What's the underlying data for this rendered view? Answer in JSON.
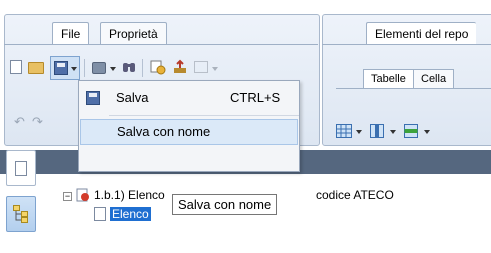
{
  "ribbon": {
    "tabs": [
      {
        "label": "File"
      },
      {
        "label": "Proprietà"
      }
    ],
    "right_group_title": "Elementi del repo",
    "inner_tabs": [
      {
        "label": "Tabelle"
      },
      {
        "label": "Cella"
      }
    ]
  },
  "save_menu": {
    "items": [
      {
        "label": "Salva",
        "shortcut": "CTRL+S"
      },
      {
        "label": "Salva con nome"
      }
    ]
  },
  "tree": {
    "root": {
      "label": "1.b.1) Elenco",
      "suffix": "codice ATECO"
    },
    "child": {
      "label": "Elenco"
    }
  },
  "tooltip": {
    "text": "Salva con nome"
  }
}
